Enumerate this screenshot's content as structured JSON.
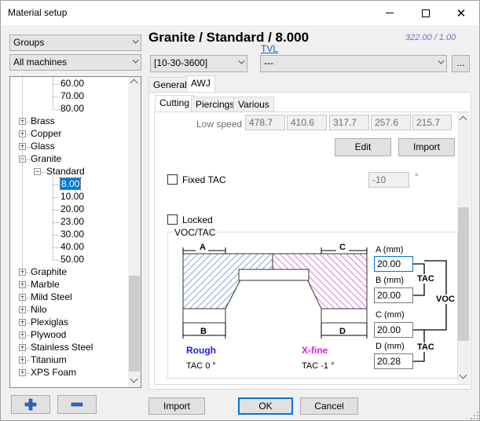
{
  "window": {
    "title": "Material setup"
  },
  "left": {
    "groups_combo": "Groups",
    "machines_combo": "All machines",
    "tree": [
      {
        "label": "60.00",
        "level": 3
      },
      {
        "label": "70.00",
        "level": 3
      },
      {
        "label": "80.00",
        "level": 3
      },
      {
        "label": "Brass",
        "level": 1
      },
      {
        "label": "Copper",
        "level": 1
      },
      {
        "label": "Glass",
        "level": 1
      },
      {
        "label": "Granite",
        "level": 1
      },
      {
        "label": "Standard",
        "level": 2
      },
      {
        "label": "8.00",
        "level": 3
      },
      {
        "label": "10.00",
        "level": 3
      },
      {
        "label": "20.00",
        "level": 3
      },
      {
        "label": "23.00",
        "level": 3
      },
      {
        "label": "30.00",
        "level": 3
      },
      {
        "label": "40.00",
        "level": 3
      },
      {
        "label": "50.00",
        "level": 3
      },
      {
        "label": "Graphite",
        "level": 1
      },
      {
        "label": "Marble",
        "level": 1
      },
      {
        "label": "Mild Steel",
        "level": 1
      },
      {
        "label": "Nilo",
        "level": 1
      },
      {
        "label": "Plexiglas",
        "level": 1
      },
      {
        "label": "Plywood",
        "level": 1
      },
      {
        "label": "Stainless Steel",
        "level": 1
      },
      {
        "label": "Titanium",
        "level": 1
      },
      {
        "label": "XPS Foam",
        "level": 1
      }
    ],
    "add_icon": "plus-icon",
    "remove_icon": "minus-icon"
  },
  "header": {
    "title": "Granite / Standard / 8.000",
    "version": "322.00 / 1.00",
    "tvl_link": "TVL",
    "range_combo": "[10-30-3600]",
    "tvl_combo": "---",
    "browse_button": "..."
  },
  "tabs": [
    "General",
    "AWJ"
  ],
  "subtabs": [
    "Cutting",
    "Piercings",
    "Various"
  ],
  "cutting": {
    "low_speed_label": "Low speed",
    "low_speed_values": [
      "478.7",
      "410.6",
      "317.7",
      "257.6",
      "215.7"
    ],
    "edit_button": "Edit",
    "import_button": "Import",
    "fixed_tac_label": "Fixed TAC",
    "fixed_tac_value": "-10",
    "degree_symbol": "°",
    "locked_label": "Locked",
    "voc_tac_title": "VOC/TAC",
    "diagram": {
      "label_a": "A",
      "label_b": "B",
      "label_c": "C",
      "label_d": "D",
      "rough_label": "Rough",
      "rough_tac": "TAC 0 °",
      "xfine_label": "X-fine",
      "xfine_tac": "TAC -1 °"
    },
    "a_label": "A (mm)",
    "a_value": "20.00",
    "b_label": "B (mm)",
    "b_value": "20.00",
    "c_label": "C (mm)",
    "c_value": "20.00",
    "d_label": "D (mm)",
    "d_value": "20.28",
    "tac_label_1": "TAC",
    "voc_label": "VOC",
    "tac_label_2": "TAC"
  },
  "footer": {
    "import_button": "Import",
    "ok_button": "OK",
    "cancel_button": "Cancel"
  },
  "colors": {
    "rough": "#1a1aff",
    "xfine": "#e020e0",
    "accent": "#0078d7"
  }
}
